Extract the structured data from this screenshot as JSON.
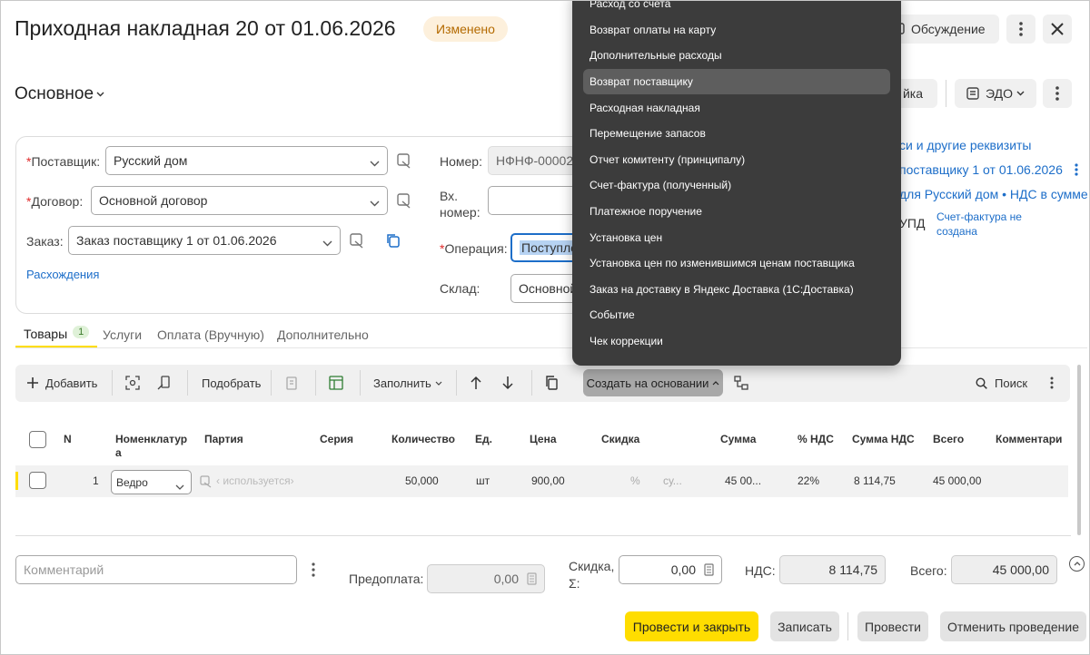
{
  "header": {
    "title": "Приходная накладная 20 от 01.06.2026",
    "status_badge": "Изменено",
    "discussion_label": "Обсуждение"
  },
  "subheader": {
    "view_select": "Основное",
    "print_partial": "йка",
    "edo_label": "ЭДО"
  },
  "form": {
    "supplier_label": "Поставщик:",
    "supplier_value": "Русский дом",
    "contract_label": "Договор:",
    "contract_value": "Основной договор",
    "order_label": "Заказ:",
    "order_value": "Заказ поставщику 1 от 01.06.2026",
    "discrepancies_link": "Расхождения",
    "number_label": "Номер:",
    "number_value": "НФНФ-00002",
    "in_number_label_1": "Вх.",
    "in_number_label_2": "номер:",
    "in_number_value": "",
    "operation_label": "Операция:",
    "operation_value": "Поступле",
    "warehouse_label": "Склад:",
    "warehouse_value": "Основной",
    "required_mark": "*"
  },
  "right_panel": {
    "props_link": "си и другие реквизиты",
    "order_link": "поставщику 1 от 01.06.2026",
    "vat_link": "для Русский дом • НДС в сумме",
    "upd_label": "УПД",
    "invoice_link_1": "Счет-фактура не",
    "invoice_link_2": "создана"
  },
  "tabs": [
    {
      "label": "Товары",
      "count": "1",
      "active": true
    },
    {
      "label": "Услуги"
    },
    {
      "label": "Оплата (Вручную)"
    },
    {
      "label": "Дополнительно"
    }
  ],
  "toolbar": {
    "add_label": "Добавить",
    "pick_label": "Подобрать",
    "fill_label": "Заполнить",
    "create_based_label": "Создать на основании",
    "search_label": "Поиск"
  },
  "table": {
    "columns": [
      "N",
      "Номенклатур",
      "а",
      "Партия",
      "Серия",
      "Количество",
      "Ед.",
      "Цена",
      "Скидка",
      "Сумма",
      "% НДС",
      "Сумма НДС",
      "Всего",
      "Комментари"
    ],
    "row": {
      "n": "1",
      "item": "Ведро",
      "batch": "‹ используется›",
      "qty": "50,000",
      "unit": "шт",
      "price": "900,00",
      "discount_pct": "%",
      "discount_sum": "су...",
      "sum": "45 00...",
      "vat_rate": "22%",
      "vat_sum": "8 114,75",
      "total": "45 000,00"
    }
  },
  "footer": {
    "comment_placeholder": "Комментарий",
    "prepay_label": "Предоплата:",
    "prepay_value": "0,00",
    "discount_label_1": "Скидка,",
    "discount_label_2": "Σ:",
    "discount_value": "0,00",
    "vat_label": "НДС:",
    "vat_value": "8 114,75",
    "total_label": "Всего:",
    "total_value": "45 000,00"
  },
  "actions": {
    "post_close": "Провести и закрыть",
    "save": "Записать",
    "post": "Провести",
    "unpost": "Отменить проведение"
  },
  "dropdown_menu": {
    "items": [
      "Расход со счета",
      "Возврат оплаты на карту",
      "Дополнительные расходы",
      "Возврат поставщику",
      "Расходная накладная",
      "Перемещение запасов",
      "Отчет комитенту (принципалу)",
      "Счет-фактура (полученный)",
      "Платежное поручение",
      "Установка цен",
      "Установка цен по изменившимся ценам поставщика",
      "Заказ на доставку в Яндекс Доставка (1С:Доставка)",
      "Событие",
      "Чек коррекции"
    ],
    "highlighted_index": 3
  },
  "colors": {
    "accent_yellow": "#ffdd00",
    "link_blue": "#1d6ec9",
    "badge_bg": "#fdf0dc",
    "badge_text": "#b46a00",
    "menu_bg": "#3c3c3c"
  }
}
